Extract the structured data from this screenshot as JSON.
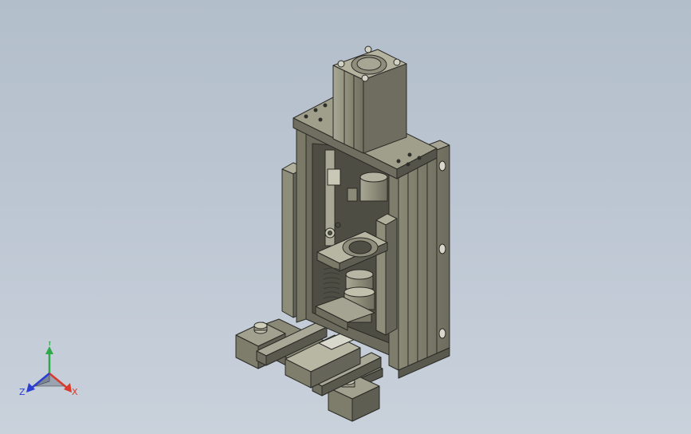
{
  "viewport": {
    "background_top": "#b3becb",
    "background_bottom": "#c9d1db"
  },
  "model": {
    "body_color": "#8e8d7a",
    "body_dark": "#5f5e52",
    "body_light": "#b4b3a0",
    "rail_color": "#9e9d8b",
    "edge_color": "#2a2a26"
  },
  "triad": {
    "x_label": "X",
    "y_label": "Y",
    "z_label": "Z",
    "x_color": "#d93a2b",
    "y_color": "#2fa84a",
    "z_color": "#2a3fd1"
  }
}
